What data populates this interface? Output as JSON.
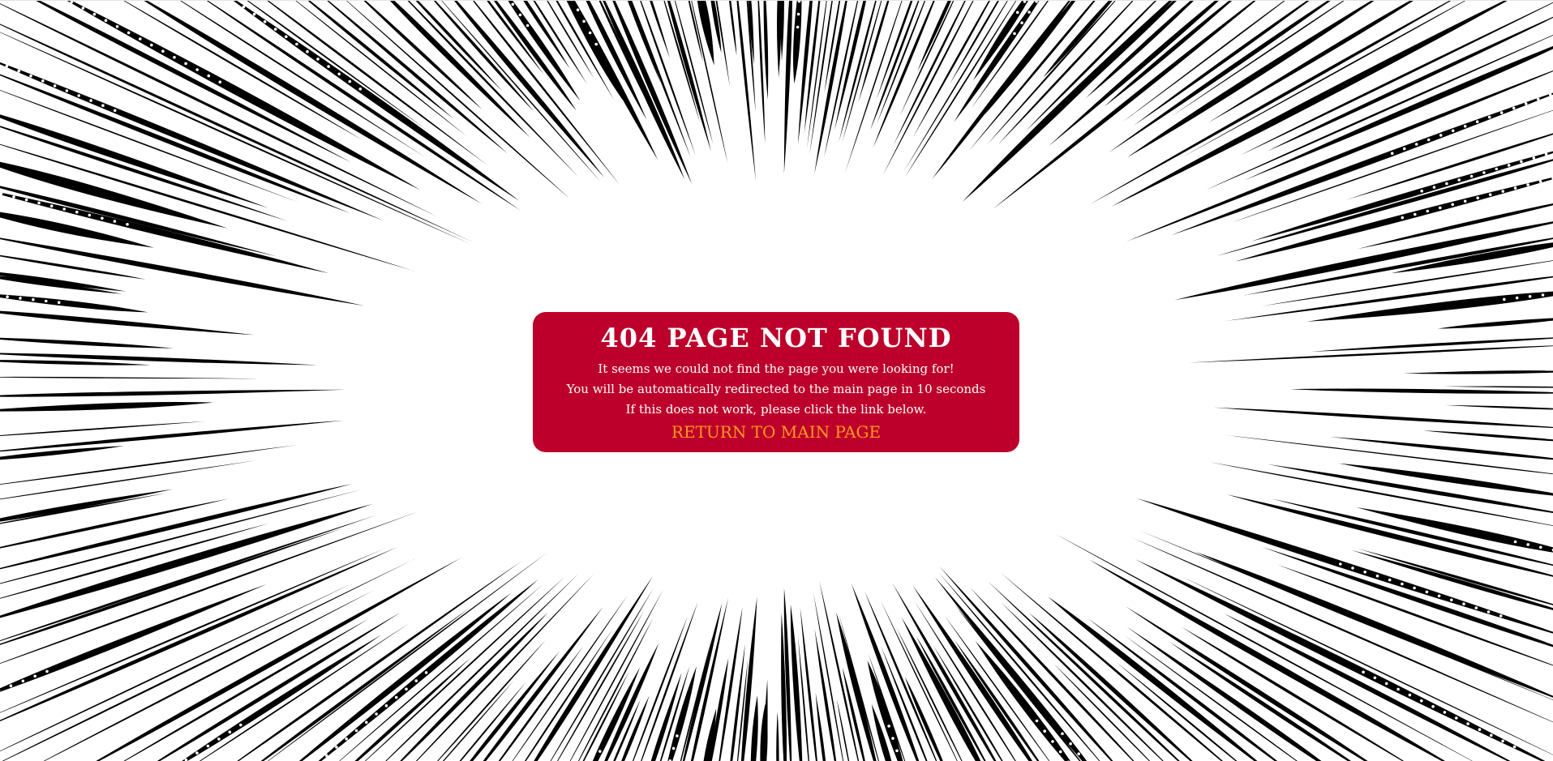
{
  "error": {
    "title": "404 PAGE NOT FOUND",
    "lines": [
      "It seems we could not find the page you were looking for!",
      "You will be automatically redirected to the main page in 10 seconds",
      "If this does not work, please click the link below."
    ],
    "link_label": "RETURN TO MAIN PAGE"
  },
  "colors": {
    "card_background": "#bd002b",
    "card_text": "#ffffff",
    "link_text": "#ff9a1f",
    "page_background": "#ffffff",
    "speed_lines": "#000000"
  },
  "background": {
    "style": "comic-speed-lines"
  }
}
